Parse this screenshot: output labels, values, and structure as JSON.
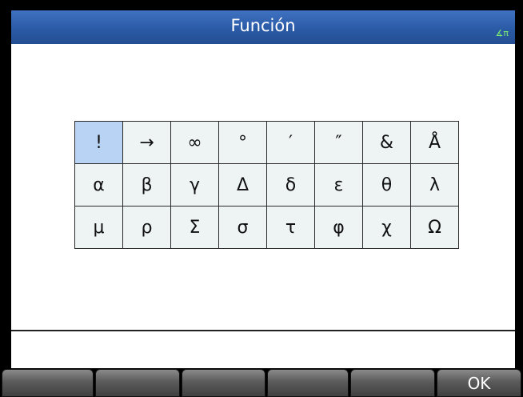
{
  "header": {
    "title": "Función",
    "angle_indicator": "∡π"
  },
  "grid": {
    "rows": [
      [
        "!",
        "→",
        "∞",
        "°",
        "′",
        "″",
        "&",
        "Å"
      ],
      [
        "α",
        "β",
        "γ",
        "Δ",
        "δ",
        "ε",
        "θ",
        "λ"
      ],
      [
        "μ",
        "ρ",
        "Σ",
        "σ",
        "τ",
        "φ",
        "χ",
        "Ω"
      ]
    ],
    "selected": "!"
  },
  "menu": {
    "keys": [
      "",
      "",
      "",
      "",
      "",
      "OK"
    ]
  },
  "colors": {
    "titlebar": "#2b5ba6",
    "selection": "#b9d3f5",
    "grid_background": "#eef4f4",
    "angle_indicator": "#7df070"
  }
}
